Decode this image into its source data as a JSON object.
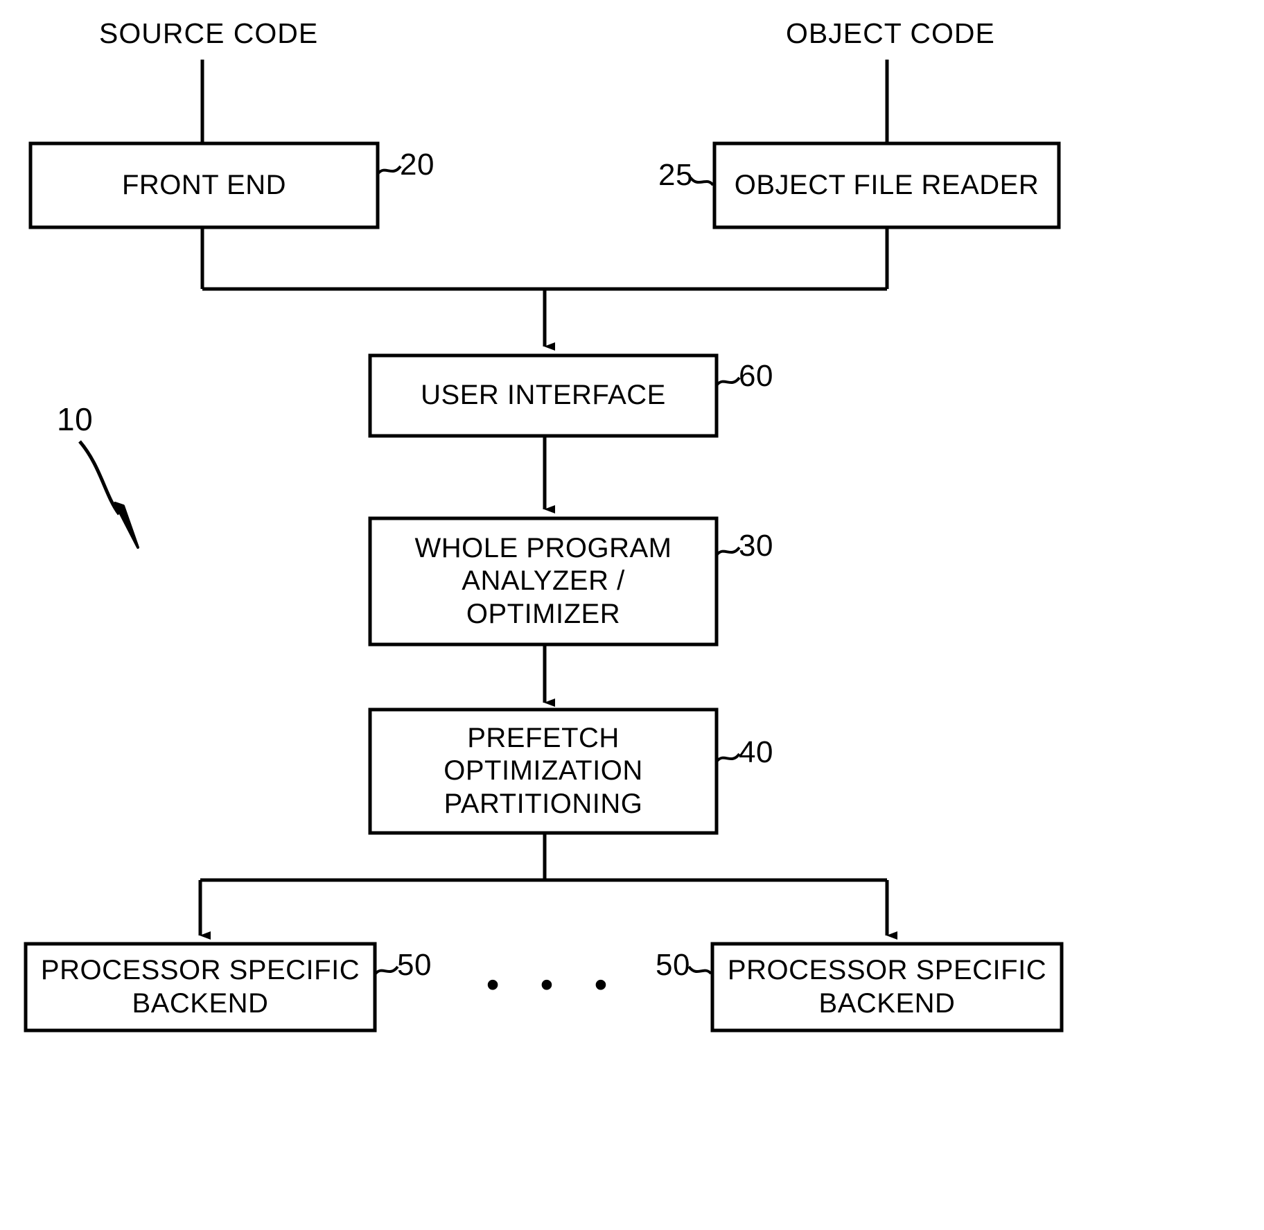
{
  "figure": {
    "type": "patent-block-diagram",
    "assembly_reference": "10",
    "inputs": [
      {
        "name": "source-code-input",
        "label": "SOURCE CODE"
      },
      {
        "name": "object-code-input",
        "label": "OBJECT CODE"
      }
    ],
    "blocks": [
      {
        "name": "front-end",
        "label": "FRONT END",
        "ref": "20",
        "ref_side": "right"
      },
      {
        "name": "object-file-reader",
        "label": "OBJECT FILE READER",
        "ref": "25",
        "ref_side": "left"
      },
      {
        "name": "user-interface",
        "label": "USER INTERFACE",
        "ref": "60",
        "ref_side": "right"
      },
      {
        "name": "whole-program-analyzer-optimizer",
        "label": "WHOLE PROGRAM\nANALYZER /\nOPTIMIZER",
        "ref": "30",
        "ref_side": "right"
      },
      {
        "name": "prefetch-optimization-partitioning",
        "label": "PREFETCH\nOPTIMIZATION\nPARTITIONING",
        "ref": "40",
        "ref_side": "right"
      },
      {
        "name": "processor-specific-backend-left",
        "label": "PROCESSOR SPECIFIC\nBACKEND",
        "ref": "50",
        "ref_side": "right"
      },
      {
        "name": "processor-specific-backend-right",
        "label": "PROCESSOR SPECIFIC\nBACKEND",
        "ref": "50",
        "ref_side": "left"
      }
    ],
    "ellipsis": "• • •",
    "colors": {
      "stroke": "#000000",
      "fill": "#ffffff",
      "text": "#000000"
    }
  }
}
